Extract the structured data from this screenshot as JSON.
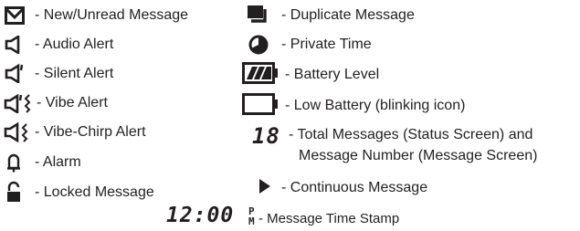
{
  "left_column": [
    {
      "icon": "envelope-icon",
      "label": "- New/Unread Message"
    },
    {
      "icon": "speaker-icon",
      "label": "- Audio Alert"
    },
    {
      "icon": "speaker-silent-icon",
      "label": "- Silent Alert"
    },
    {
      "icon": "speaker-vibe-icon",
      "label": "- Vibe Alert"
    },
    {
      "icon": "speaker-vibe-chirp-icon",
      "label": "- Vibe-Chirp Alert"
    },
    {
      "icon": "bell-icon",
      "label": "- Alarm"
    },
    {
      "icon": "padlock-icon",
      "label": "- Locked Message"
    }
  ],
  "right_column": [
    {
      "icon": "duplicate-message-icon",
      "label": "- Duplicate Message"
    },
    {
      "icon": "clock-pie-icon",
      "label": "- Private Time"
    },
    {
      "icon": "battery-full-icon",
      "label": "- Battery Level"
    },
    {
      "icon": "battery-empty-icon",
      "label": "- Low Battery (blinking icon)"
    },
    {
      "icon": "digits-icon",
      "label": "- Total Messages (Status Screen) and",
      "label_line2": "Message Number (Message Screen)",
      "digits": "18"
    },
    {
      "icon": "play-triangle-icon",
      "label": "- Continuous Message"
    }
  ],
  "timestamp": {
    "digits": "12:00",
    "pm_top": "P",
    "pm_bottom": "M",
    "label": "- Message Time Stamp"
  }
}
